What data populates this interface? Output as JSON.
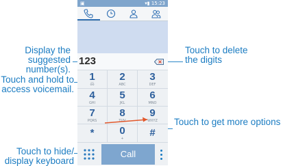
{
  "status": {
    "left": "▣",
    "right": "▾▮ 15:23"
  },
  "tabs": [
    {
      "icon": "phone-icon",
      "active": true
    },
    {
      "icon": "clock-icon",
      "active": false
    },
    {
      "icon": "contact-icon",
      "active": false
    },
    {
      "icon": "group-icon",
      "active": false
    }
  ],
  "dialer": {
    "number": "123",
    "keys": [
      {
        "digit": "1",
        "sub": "o͞o"
      },
      {
        "digit": "2",
        "sub": "ABC"
      },
      {
        "digit": "3",
        "sub": "DEF"
      },
      {
        "digit": "4",
        "sub": "GHI"
      },
      {
        "digit": "5",
        "sub": "JKL"
      },
      {
        "digit": "6",
        "sub": "MNO"
      },
      {
        "digit": "7",
        "sub": "PQRS"
      },
      {
        "digit": "8",
        "sub": "TUV"
      },
      {
        "digit": "9",
        "sub": "WXYZ"
      },
      {
        "digit": "*",
        "sub": ""
      },
      {
        "digit": "0",
        "sub": "+"
      },
      {
        "digit": "#",
        "sub": ""
      }
    ],
    "call_label": "Call"
  },
  "callouts": {
    "display_number": "Display the\nsuggested\nnumber(s).",
    "voicemail": "Touch and hold to\naccess voicemail.",
    "hide_keyboard": "Touch to hide/\ndisplay keyboard",
    "delete_digits": "Touch to delete\nthe digits",
    "more_options": "Touch to get more options"
  },
  "colors": {
    "callout_text": "#1b7cc2",
    "accent_arrow": "#e2572a",
    "call_button": "#7ea6cf",
    "digit": "#2d5f9c"
  }
}
